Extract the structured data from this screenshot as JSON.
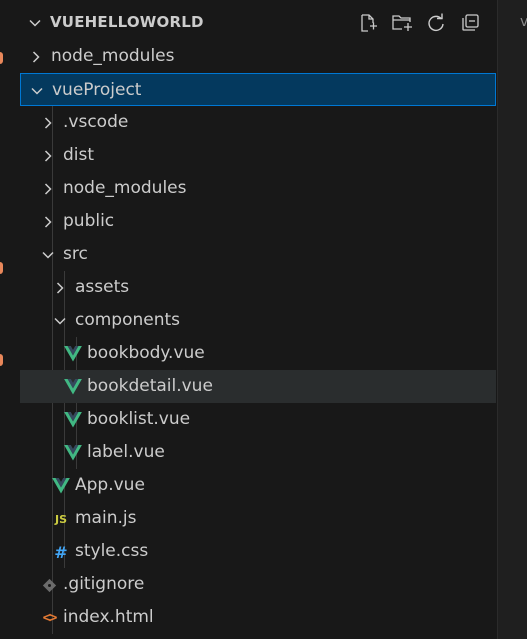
{
  "explorer": {
    "title": "VUEHELLOWORLD",
    "actions": [
      {
        "name": "new-file-icon"
      },
      {
        "name": "new-folder-icon"
      },
      {
        "name": "refresh-icon"
      },
      {
        "name": "collapse-all-icon"
      }
    ]
  },
  "right_pane": {
    "glyph": "v"
  },
  "tree": [
    {
      "label": "node_modules",
      "type": "folder",
      "expanded": false,
      "depth": 0
    },
    {
      "label": "vueProject",
      "type": "folder",
      "expanded": true,
      "depth": 0,
      "selected": true
    },
    {
      "label": ".vscode",
      "type": "folder",
      "expanded": false,
      "depth": 1
    },
    {
      "label": "dist",
      "type": "folder",
      "expanded": false,
      "depth": 1
    },
    {
      "label": "node_modules",
      "type": "folder",
      "expanded": false,
      "depth": 1
    },
    {
      "label": "public",
      "type": "folder",
      "expanded": false,
      "depth": 1
    },
    {
      "label": "src",
      "type": "folder",
      "expanded": true,
      "depth": 1
    },
    {
      "label": "assets",
      "type": "folder",
      "expanded": false,
      "depth": 2
    },
    {
      "label": "components",
      "type": "folder",
      "expanded": true,
      "depth": 2
    },
    {
      "label": "bookbody.vue",
      "type": "vue",
      "depth": 3
    },
    {
      "label": "bookdetail.vue",
      "type": "vue",
      "depth": 3,
      "hover": true
    },
    {
      "label": "booklist.vue",
      "type": "vue",
      "depth": 3
    },
    {
      "label": "label.vue",
      "type": "vue",
      "depth": 3
    },
    {
      "label": "App.vue",
      "type": "vue",
      "depth": 2
    },
    {
      "label": "main.js",
      "type": "js",
      "depth": 2
    },
    {
      "label": "style.css",
      "type": "css",
      "depth": 2
    },
    {
      "label": ".gitignore",
      "type": "git",
      "depth": 1
    },
    {
      "label": "index.html",
      "type": "html",
      "depth": 1
    }
  ],
  "colors": {
    "background": "#181818",
    "selection": "#04395e",
    "selection_border": "#0078d4",
    "hover": "#2a2d2e",
    "vue_green": "#41b883",
    "vue_dark": "#35495e",
    "js_yellow": "#cbcb41",
    "css_blue": "#42a5f5",
    "html_orange": "#e37933"
  }
}
